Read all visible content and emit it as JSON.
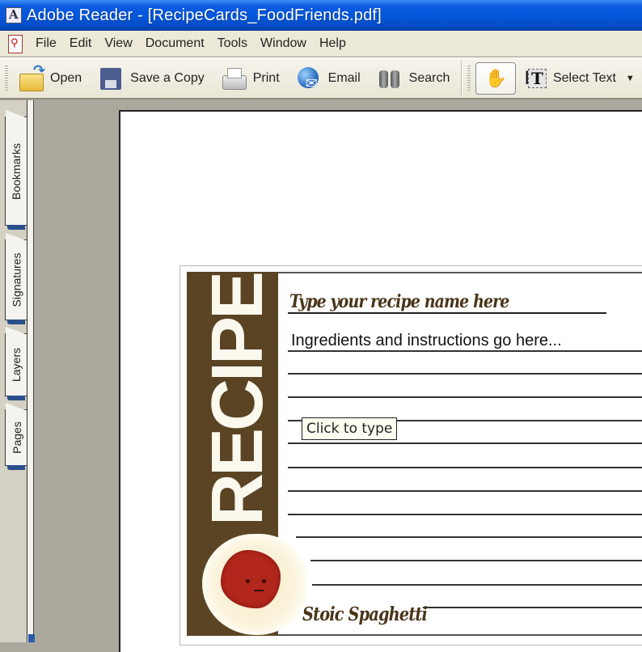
{
  "window": {
    "title": "Adobe Reader - [RecipeCards_FoodFriends.pdf]",
    "app_icon": "adobe-reader-icon"
  },
  "menubar": {
    "icon": "pdf-document-icon",
    "items": [
      {
        "label": "File"
      },
      {
        "label": "Edit"
      },
      {
        "label": "View"
      },
      {
        "label": "Document"
      },
      {
        "label": "Tools"
      },
      {
        "label": "Window"
      },
      {
        "label": "Help"
      }
    ]
  },
  "toolbar": {
    "buttons": [
      {
        "label": "Open",
        "icon": "open-folder-icon"
      },
      {
        "label": "Save a Copy",
        "icon": "floppy-disk-icon"
      },
      {
        "label": "Print",
        "icon": "printer-icon"
      },
      {
        "label": "Email",
        "icon": "email-globe-icon"
      },
      {
        "label": "Search",
        "icon": "binoculars-icon"
      }
    ],
    "hand_tool": {
      "icon": "hand-icon",
      "glyph": "✋",
      "active": true
    },
    "select_text": {
      "label": "Select Text",
      "icon": "select-text-icon",
      "glyph": "T",
      "beam": "I",
      "arrow": "▼"
    }
  },
  "navigation_pane": {
    "tabs": [
      {
        "label": "Bookmarks"
      },
      {
        "label": "Signatures"
      },
      {
        "label": "Layers"
      },
      {
        "label": "Pages"
      }
    ]
  },
  "document": {
    "card": {
      "side_label": "RECIPE",
      "recipe_name_placeholder": "Type your recipe name here",
      "ingredients_placeholder": "Ingredients and instructions go here...",
      "tooltip": "Click to type",
      "character_name": "Stoic Spaghetti"
    },
    "colors": {
      "band": "#5a4424",
      "title_text": "#4a3418",
      "sauce": "#b2261b"
    }
  }
}
